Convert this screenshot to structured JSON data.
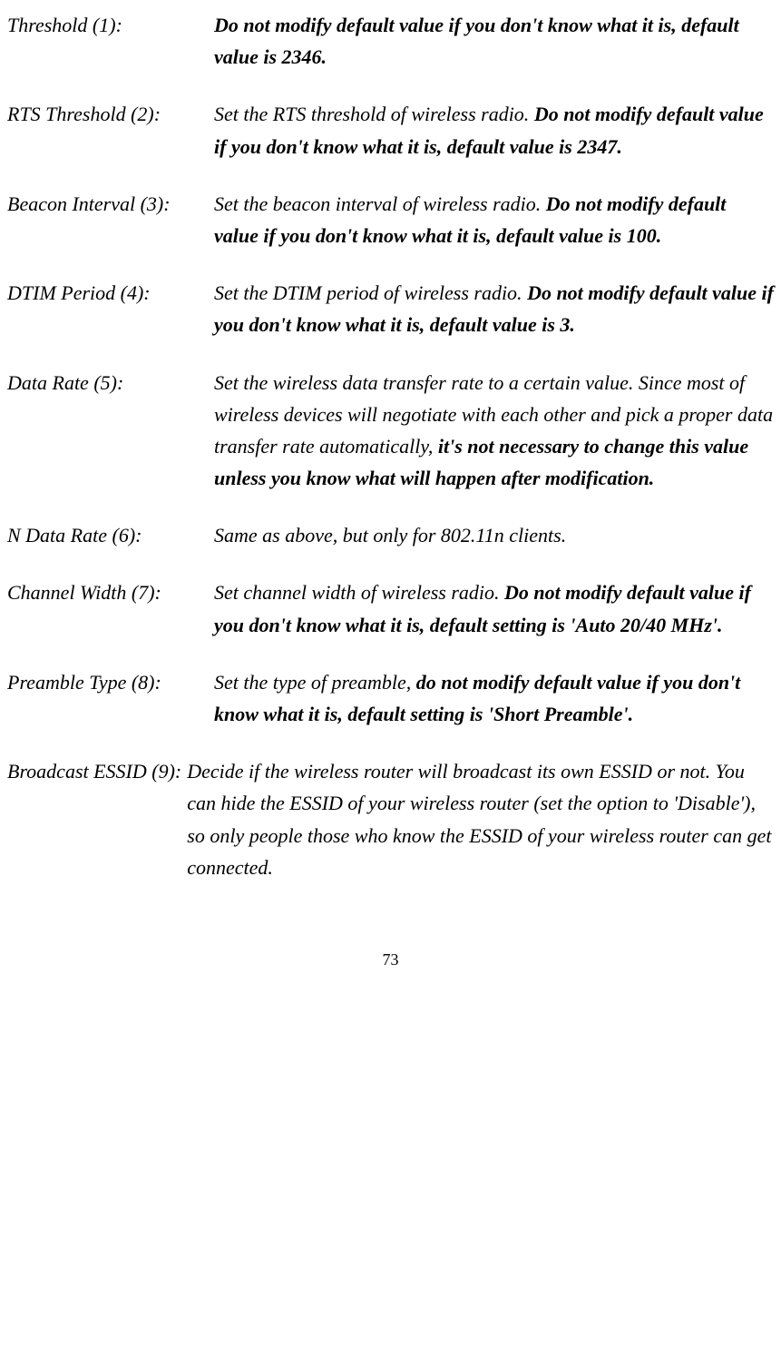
{
  "items": [
    {
      "label": "Threshold (1):",
      "desc_pre": "",
      "desc_bold": "Do not modify default value if you don't know what it is, default value is 2346.",
      "desc_post": ""
    },
    {
      "label": "RTS Threshold (2):",
      "desc_pre": "Set the RTS threshold of wireless radio. ",
      "desc_bold": "Do not modify default value if you don't know what it is, default value is 2347.",
      "desc_post": ""
    },
    {
      "label": "Beacon Interval (3):",
      "desc_pre": "Set the beacon interval of wireless radio. ",
      "desc_bold": "Do not modify default value if you don't know what it is, default value is 100.",
      "desc_post": ""
    },
    {
      "label": "DTIM Period (4):",
      "desc_pre": "Set the DTIM period of wireless radio. ",
      "desc_bold": "Do not modify default value if you don't know what it is, default value is 3.",
      "desc_post": ""
    },
    {
      "label": "Data Rate (5):",
      "desc_pre": "Set the wireless data transfer rate to a certain value. Since most of wireless devices will negotiate with each other and pick a proper data transfer rate automatically, ",
      "desc_bold": "it's not necessary to change this value unless you know what will happen after modification.",
      "desc_post": ""
    },
    {
      "label": "N Data Rate (6):",
      "desc_pre": "Same as above, but only for 802.11n clients.",
      "desc_bold": "",
      "desc_post": ""
    },
    {
      "label": "Channel Width (7):",
      "desc_pre": "Set channel width of wireless radio. ",
      "desc_bold": "Do not modify default value if you don't know what it is, default setting is 'Auto 20/40 MHz'.",
      "desc_post": ""
    },
    {
      "label": "Preamble Type (8):",
      "desc_pre": "Set the type of preamble, ",
      "desc_bold": "do not modify default value if you don't know what it is, default setting is 'Short Preamble'.",
      "desc_post": ""
    },
    {
      "label": "Broadcast ESSID (9):",
      "desc_pre": "Decide if the wireless router will broadcast its own ESSID or not. You can hide the ESSID of your wireless router (set the option to 'Disable'), so only people those who know the ESSID of your wireless router can get connected.",
      "desc_bold": "",
      "desc_post": ""
    }
  ],
  "page_number": "73"
}
